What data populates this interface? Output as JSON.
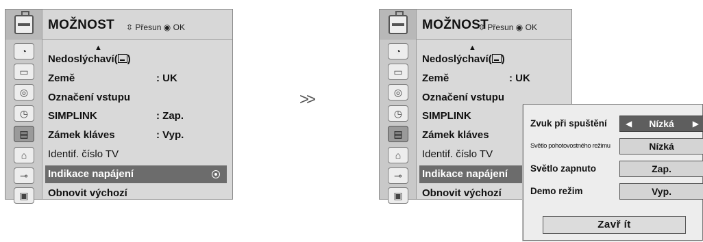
{
  "menu": {
    "title": "MOŽNOST",
    "nav_hint": "Přesun",
    "ok_label": "OK",
    "icons": [
      "satellite-dish-icon",
      "monitor-icon",
      "speaker-icon",
      "clock-icon",
      "option-icon",
      "lock-icon",
      "input-cable-icon",
      "photo-music-icon"
    ],
    "items": [
      {
        "label": "Nedoslýchaví(",
        "label_suffix": ")",
        "value": ""
      },
      {
        "label": "Země",
        "value": ": UK"
      },
      {
        "label": "Označení vstupu",
        "value": ""
      },
      {
        "label": "SIMPLINK",
        "value": ": Zap."
      },
      {
        "label": "Zámek kláves",
        "value": ": Vyp."
      },
      {
        "label": "Identif. číslo TV",
        "value": ""
      },
      {
        "label": "Indikace napájení",
        "value": ""
      },
      {
        "label": "Obnovit výchozí",
        "value": ""
      }
    ]
  },
  "popup": {
    "rows": [
      {
        "label": "Zvuk při spuštění",
        "value": "Nízká"
      },
      {
        "label": "Světlo pohotovostného režimu",
        "value": "Nízká"
      },
      {
        "label": "Světlo zapnuto",
        "value": "Zap."
      },
      {
        "label": "Demo režim",
        "value": "Vyp."
      }
    ],
    "close_label": "Zavř ít"
  },
  "colors": {
    "selected_row": "#6c6c6c",
    "popup_active": "#5e5e5e",
    "menu_bg": "#d9d9d9"
  }
}
